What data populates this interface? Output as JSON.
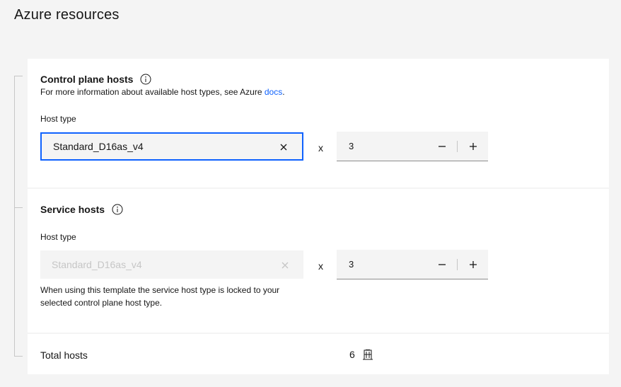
{
  "page": {
    "title": "Azure resources"
  },
  "control_plane": {
    "heading": "Control plane hosts",
    "help_prefix": "For more information about available host types, see Azure",
    "help_link": "docs",
    "help_suffix": ".",
    "host_type_label": "Host type",
    "host_type_value": "Standard_D16as_v4",
    "multiplier": "x",
    "count": "3"
  },
  "service": {
    "heading": "Service hosts",
    "host_type_label": "Host type",
    "host_type_value": "Standard_D16as_v4",
    "multiplier": "x",
    "count": "3",
    "note": "When using this template the service host type is locked to your selected control plane host type."
  },
  "total": {
    "label": "Total hosts",
    "value": "6"
  },
  "colors": {
    "accent": "#0f62fe",
    "surface": "#ffffff",
    "background": "#f4f4f4"
  }
}
